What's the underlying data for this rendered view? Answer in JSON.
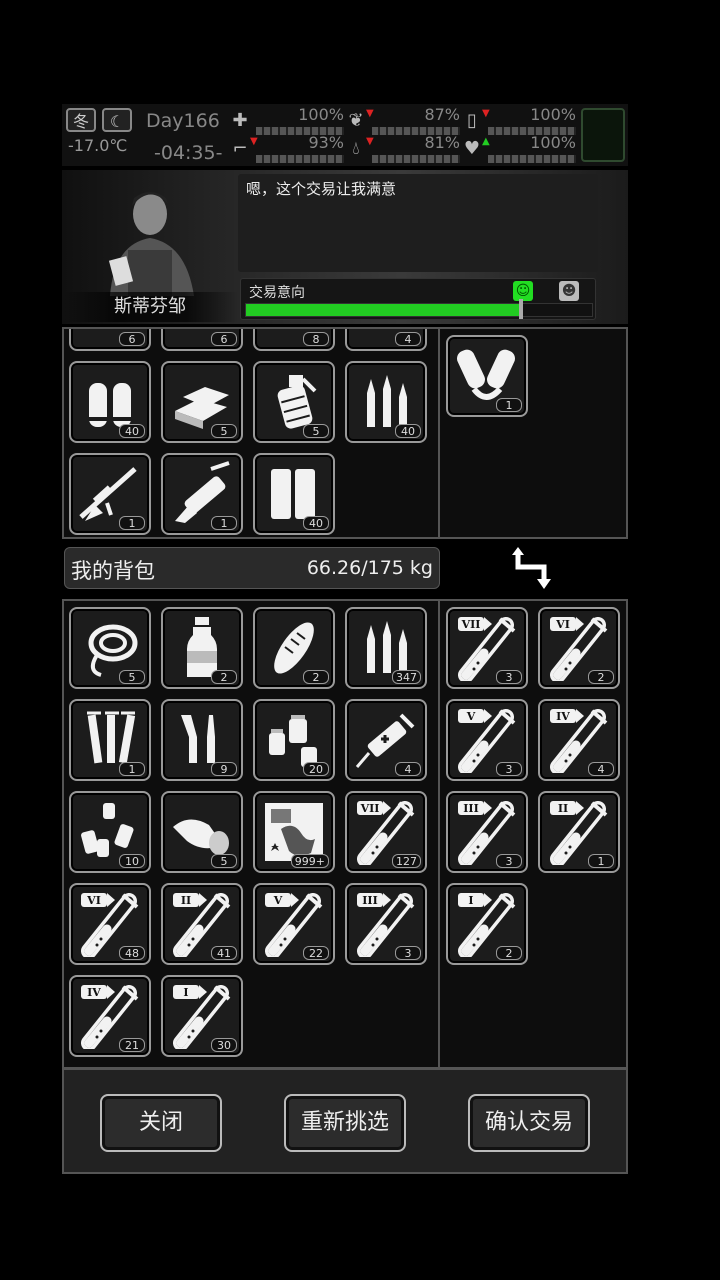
{
  "status": {
    "season": "冬",
    "temperature": "-17.0℃",
    "day": "Day166",
    "time": "-04:35-",
    "stats": [
      {
        "icon": "health-kit-icon",
        "value": "100%"
      },
      {
        "icon": "stomach-icon",
        "value": "87%"
      },
      {
        "icon": "battery-icon",
        "value": "100%"
      },
      {
        "icon": "boot-icon",
        "value": "93%"
      },
      {
        "icon": "water-drop-icon",
        "value": "81%"
      },
      {
        "icon": "heart-icon",
        "value": "100%"
      }
    ]
  },
  "trader": {
    "name": "斯蒂芬邹",
    "dialog": "嗯，这个交易让我满意",
    "intent_label": "交易意向",
    "intent_level": 0.8
  },
  "trader_items": [
    {
      "icon": "partial-item-icon",
      "qty": "6"
    },
    {
      "icon": "partial-item-icon",
      "qty": "6"
    },
    {
      "icon": "partial-item-icon",
      "qty": "8"
    },
    {
      "icon": "partial-item-icon",
      "qty": "4"
    },
    {
      "icon": "shotgun-shells-icon",
      "qty": "40"
    },
    {
      "icon": "gold-bars-icon",
      "qty": "5"
    },
    {
      "icon": "grenade-icon",
      "qty": "5"
    },
    {
      "icon": "rifle-ammo-icon",
      "qty": "40"
    },
    {
      "icon": "sniper-rifle-icon",
      "qty": "1"
    },
    {
      "icon": "minigun-icon",
      "qty": "1"
    },
    {
      "icon": "magazine-icon",
      "qty": "40"
    }
  ],
  "trader_offer": [
    {
      "icon": "arm-guards-icon",
      "qty": "1"
    }
  ],
  "backpack": {
    "title": "我的背包",
    "weight": "66.26/175 kg",
    "items": [
      {
        "icon": "rope-icon",
        "qty": "5"
      },
      {
        "icon": "water-bottle-icon",
        "qty": "2"
      },
      {
        "icon": "bread-icon",
        "qty": "2"
      },
      {
        "icon": "rifle-ammo-icon",
        "qty": "347"
      },
      {
        "icon": "syringes-icon",
        "qty": "1"
      },
      {
        "icon": "ampoules-icon",
        "qty": "9"
      },
      {
        "icon": "pill-bottles-icon",
        "qty": "20"
      },
      {
        "icon": "adrenaline-syringe-icon",
        "qty": "4"
      },
      {
        "icon": "medicine-vials-icon",
        "qty": "10"
      },
      {
        "icon": "bandage-roll-icon",
        "qty": "5"
      },
      {
        "icon": "map-icon",
        "qty": "999+"
      },
      {
        "icon": "test-tube-icon",
        "tier": "VII",
        "qty": "127"
      },
      {
        "icon": "test-tube-icon",
        "tier": "VI",
        "qty": "48"
      },
      {
        "icon": "test-tube-icon",
        "tier": "II",
        "qty": "41"
      },
      {
        "icon": "test-tube-icon",
        "tier": "V",
        "qty": "22"
      },
      {
        "icon": "test-tube-icon",
        "tier": "III",
        "qty": "3"
      },
      {
        "icon": "test-tube-icon",
        "tier": "IV",
        "qty": "21"
      },
      {
        "icon": "test-tube-icon",
        "tier": "I",
        "qty": "30"
      }
    ],
    "offer": [
      {
        "icon": "test-tube-icon",
        "tier": "VII",
        "qty": "3"
      },
      {
        "icon": "test-tube-icon",
        "tier": "VI",
        "qty": "2"
      },
      {
        "icon": "test-tube-icon",
        "tier": "V",
        "qty": "3"
      },
      {
        "icon": "test-tube-icon",
        "tier": "IV",
        "qty": "4"
      },
      {
        "icon": "test-tube-icon",
        "tier": "III",
        "qty": "3"
      },
      {
        "icon": "test-tube-icon",
        "tier": "II",
        "qty": "1"
      },
      {
        "icon": "test-tube-icon",
        "tier": "I",
        "qty": "2"
      }
    ]
  },
  "buttons": {
    "close": "关闭",
    "reselect": "重新挑选",
    "confirm": "确认交易"
  }
}
